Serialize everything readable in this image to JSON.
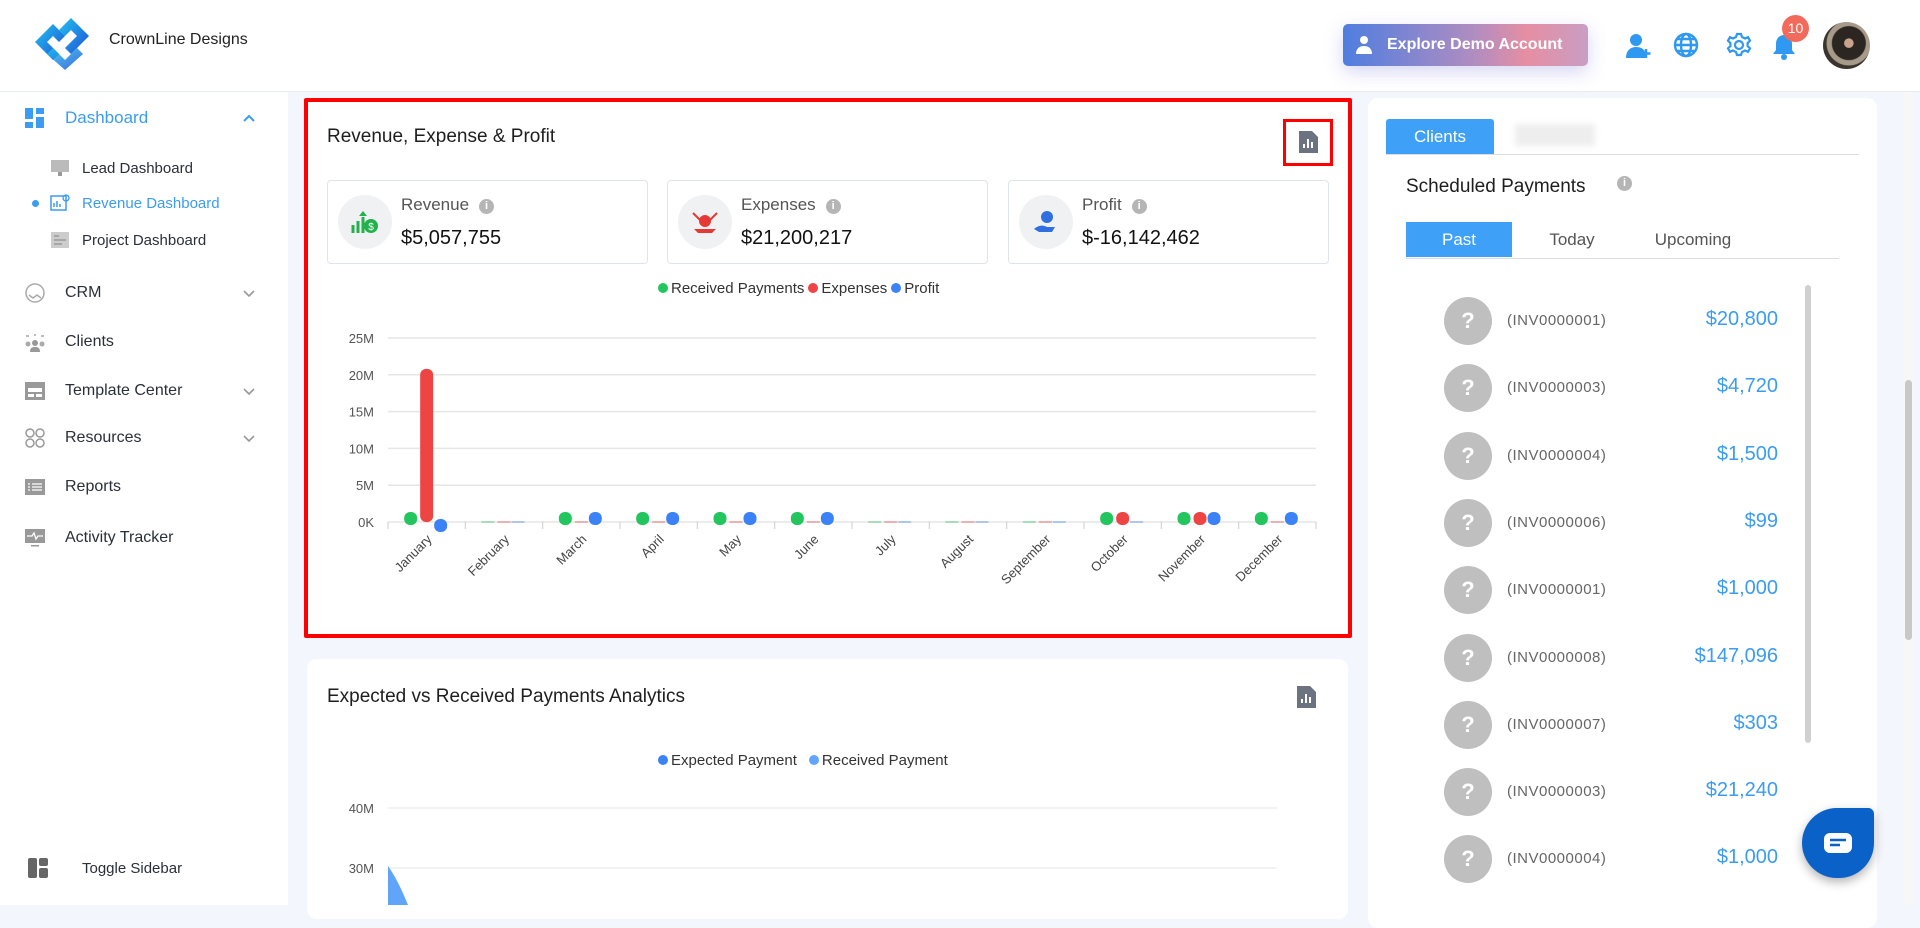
{
  "header": {
    "brand": "CrownLine Designs",
    "demo_button": "Explore Demo Account",
    "notification_count": "10"
  },
  "sidebar": {
    "dashboard": "Dashboard",
    "sub_items": [
      "Lead Dashboard",
      "Revenue Dashboard",
      "Project Dashboard"
    ],
    "items": [
      "CRM",
      "Clients",
      "Template Center",
      "Resources",
      "Reports",
      "Activity Tracker"
    ],
    "toggle": "Toggle Sidebar"
  },
  "rep_card": {
    "title": "Revenue, Expense & Profit",
    "stats": [
      {
        "label": "Revenue",
        "value": "$5,057,755"
      },
      {
        "label": "Expenses",
        "value": "$21,200,217"
      },
      {
        "label": "Profit",
        "value": "$-16,142,462"
      }
    ]
  },
  "chart_data": [
    {
      "type": "bar",
      "title": "Revenue, Expense & Profit",
      "categories": [
        "January",
        "February",
        "March",
        "April",
        "May",
        "June",
        "July",
        "August",
        "September",
        "October",
        "November",
        "December"
      ],
      "series": [
        {
          "name": "Received Payments",
          "color": "#22c55e",
          "values": [
            0.05,
            0,
            1.2,
            0.05,
            1.3,
            0.1,
            0,
            0,
            0,
            0.05,
            0.4,
            0.35
          ]
        },
        {
          "name": "Expenses",
          "color": "#ef4444",
          "values": [
            20.8,
            0,
            0,
            0,
            0,
            0,
            0,
            0,
            0,
            0.05,
            0.05,
            0
          ]
        },
        {
          "name": "Profit",
          "color": "#3b82f6",
          "values": [
            -0.2,
            0,
            1.2,
            0.05,
            1.3,
            0.1,
            0,
            0,
            0,
            0,
            0.35,
            0.35
          ]
        }
      ],
      "yticks": [
        "0K",
        "5M",
        "10M",
        "15M",
        "20M",
        "25M"
      ],
      "ylim": [
        0,
        25
      ],
      "yunit": "M",
      "legend": "top-center",
      "grid": true
    },
    {
      "type": "area",
      "title": "Expected vs Received Payments Analytics",
      "series": [
        {
          "name": "Expected Payment",
          "color": "#3b82f6"
        },
        {
          "name": "Received Payment",
          "color": "#60a5fa"
        }
      ],
      "yticks_visible": [
        "40M",
        "30M"
      ],
      "first_value": 30,
      "legend": "top-center"
    }
  ],
  "right_panel": {
    "tabs": [
      "Clients"
    ],
    "section_title": "Scheduled Payments",
    "sub_tabs": [
      "Past",
      "Today",
      "Upcoming"
    ],
    "payments": [
      {
        "invoice": "(INV0000001)",
        "amount": "$20,800"
      },
      {
        "invoice": "(INV0000003)",
        "amount": "$4,720"
      },
      {
        "invoice": "(INV0000004)",
        "amount": "$1,500"
      },
      {
        "invoice": "(INV0000006)",
        "amount": "$99"
      },
      {
        "invoice": "(INV0000001)",
        "amount": "$1,000"
      },
      {
        "invoice": "(INV0000008)",
        "amount": "$147,096"
      },
      {
        "invoice": "(INV0000007)",
        "amount": "$303"
      },
      {
        "invoice": "(INV0000003)",
        "amount": "$21,240"
      },
      {
        "invoice": "(INV0000004)",
        "amount": "$1,000"
      }
    ],
    "avatar_placeholder": "?"
  }
}
